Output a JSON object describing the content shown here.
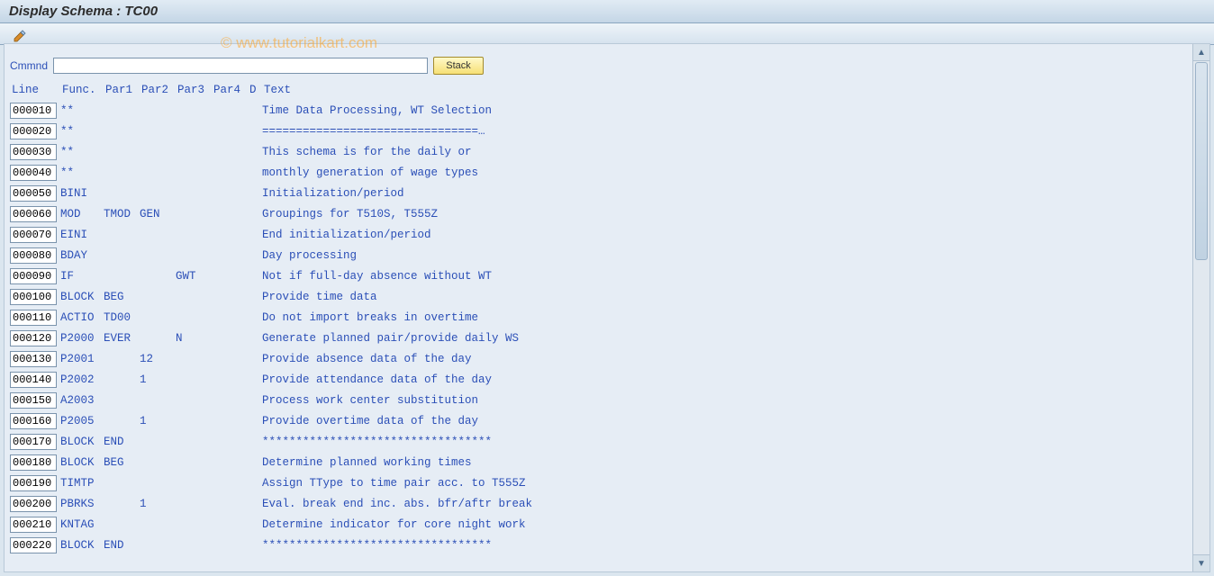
{
  "title": "Display Schema : TC00",
  "watermark": "© www.tutorialkart.com",
  "command": {
    "label": "Cmmnd",
    "value": "",
    "stack_label": "Stack"
  },
  "headers": {
    "line": "Line",
    "func": "Func.",
    "par1": "Par1",
    "par2": "Par2",
    "par3": "Par3",
    "par4": "Par4",
    "d": "D",
    "text": "Text"
  },
  "rows": [
    {
      "line": "000010",
      "func": "**",
      "par1": "",
      "par2": "",
      "par3": "",
      "par4": "",
      "d": "",
      "text": "Time Data Processing, WT Selection"
    },
    {
      "line": "000020",
      "func": "**",
      "par1": "",
      "par2": "",
      "par3": "",
      "par4": "",
      "d": "",
      "text": "================================…"
    },
    {
      "line": "000030",
      "func": "**",
      "par1": "",
      "par2": "",
      "par3": "",
      "par4": "",
      "d": "",
      "text": "This schema is for the daily or"
    },
    {
      "line": "000040",
      "func": "**",
      "par1": "",
      "par2": "",
      "par3": "",
      "par4": "",
      "d": "",
      "text": "monthly generation of wage types"
    },
    {
      "line": "000050",
      "func": "BINI",
      "par1": "",
      "par2": "",
      "par3": "",
      "par4": "",
      "d": "",
      "text": "Initialization/period"
    },
    {
      "line": "000060",
      "func": "MOD",
      "par1": "TMOD",
      "par2": "GEN",
      "par3": "",
      "par4": "",
      "d": "",
      "text": "Groupings for T510S, T555Z"
    },
    {
      "line": "000070",
      "func": "EINI",
      "par1": "",
      "par2": "",
      "par3": "",
      "par4": "",
      "d": "",
      "text": "End initialization/period"
    },
    {
      "line": "000080",
      "func": "BDAY",
      "par1": "",
      "par2": "",
      "par3": "",
      "par4": "",
      "d": "",
      "text": "Day processing"
    },
    {
      "line": "000090",
      "func": "IF",
      "par1": "",
      "par2": "",
      "par3": "GWT",
      "par4": "",
      "d": "",
      "text": "Not if full-day absence without WT"
    },
    {
      "line": "000100",
      "func": "BLOCK",
      "par1": "BEG",
      "par2": "",
      "par3": "",
      "par4": "",
      "d": "",
      "text": "Provide time data"
    },
    {
      "line": "000110",
      "func": "ACTIO",
      "par1": "TD00",
      "par2": "",
      "par3": "",
      "par4": "",
      "d": "",
      "text": "Do not import breaks in overtime"
    },
    {
      "line": "000120",
      "func": "P2000",
      "par1": "EVER",
      "par2": "",
      "par3": "N",
      "par4": "",
      "d": "",
      "text": "Generate planned pair/provide daily WS"
    },
    {
      "line": "000130",
      "func": "P2001",
      "par1": "",
      "par2": "12",
      "par3": "",
      "par4": "",
      "d": "",
      "text": "Provide absence data of the day"
    },
    {
      "line": "000140",
      "func": "P2002",
      "par1": "",
      "par2": "1",
      "par3": "",
      "par4": "",
      "d": "",
      "text": "Provide attendance data of the day"
    },
    {
      "line": "000150",
      "func": "A2003",
      "par1": "",
      "par2": "",
      "par3": "",
      "par4": "",
      "d": "",
      "text": "Process work center substitution"
    },
    {
      "line": "000160",
      "func": "P2005",
      "par1": "",
      "par2": "1",
      "par3": "",
      "par4": "",
      "d": "",
      "text": "Provide overtime data of the day"
    },
    {
      "line": "000170",
      "func": "BLOCK",
      "par1": "END",
      "par2": "",
      "par3": "",
      "par4": "",
      "d": "",
      "text": "**********************************"
    },
    {
      "line": "000180",
      "func": "BLOCK",
      "par1": "BEG",
      "par2": "",
      "par3": "",
      "par4": "",
      "d": "",
      "text": "Determine planned working times"
    },
    {
      "line": "000190",
      "func": "TIMTP",
      "par1": "",
      "par2": "",
      "par3": "",
      "par4": "",
      "d": "",
      "text": "Assign TType to time pair acc. to T555Z"
    },
    {
      "line": "000200",
      "func": "PBRKS",
      "par1": "",
      "par2": "1",
      "par3": "",
      "par4": "",
      "d": "",
      "text": "Eval. break end inc. abs. bfr/aftr break"
    },
    {
      "line": "000210",
      "func": "KNTAG",
      "par1": "",
      "par2": "",
      "par3": "",
      "par4": "",
      "d": "",
      "text": "Determine indicator for core night work"
    },
    {
      "line": "000220",
      "func": "BLOCK",
      "par1": "END",
      "par2": "",
      "par3": "",
      "par4": "",
      "d": "",
      "text": "**********************************"
    }
  ]
}
